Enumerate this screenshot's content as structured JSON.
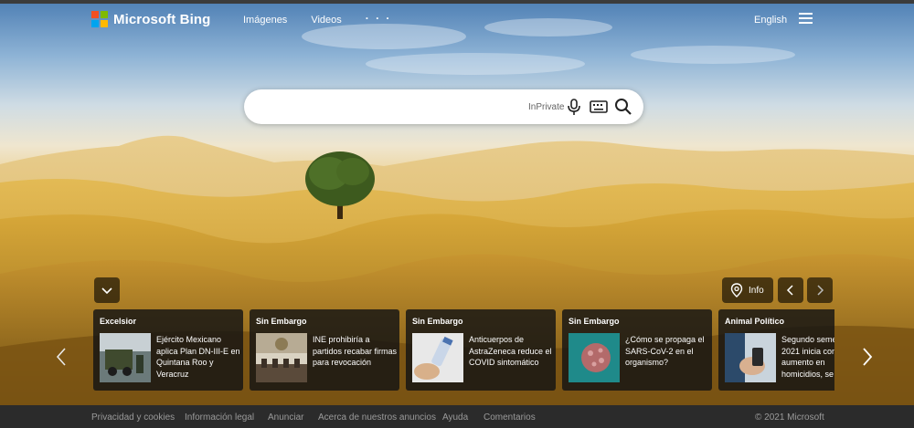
{
  "header": {
    "logo_text": "Microsoft Bing",
    "nav": [
      {
        "label": "Imágenes"
      },
      {
        "label": "Videos"
      },
      {
        "label": "· · ·"
      }
    ],
    "language": "English"
  },
  "search": {
    "value": "",
    "placeholder": "",
    "inprivate_label": "InPrivate"
  },
  "controls": {
    "info_label": "Info"
  },
  "news": [
    {
      "source": "Excelsior",
      "title": "Ejército Mexicano aplica Plan DN-III-E en Quintana Roo y Veracruz"
    },
    {
      "source": "Sin Embargo",
      "title": "INE prohibiría a partidos recabar firmas para revocación"
    },
    {
      "source": "Sin Embargo",
      "title": "Anticuerpos de AstraZeneca reduce el COVID sintomático"
    },
    {
      "source": "Sin Embargo",
      "title": "¿Cómo se propaga el SARS-CoV-2 en el organismo?"
    },
    {
      "source": "Animal Político",
      "title": "Segundo semestre de 2021 inicia con aumento en homicidios, se"
    }
  ],
  "footer": {
    "links": [
      "Privacidad y cookies",
      "Información legal",
      "Anunciar",
      "Acerca de nuestros anuncios",
      "Ayuda",
      "Comentarios"
    ],
    "copyright": "© 2021 Microsoft"
  },
  "colors": {
    "logo_red": "#f25022",
    "logo_green": "#7fba00",
    "logo_blue": "#00a4ef",
    "logo_yellow": "#ffb900"
  }
}
